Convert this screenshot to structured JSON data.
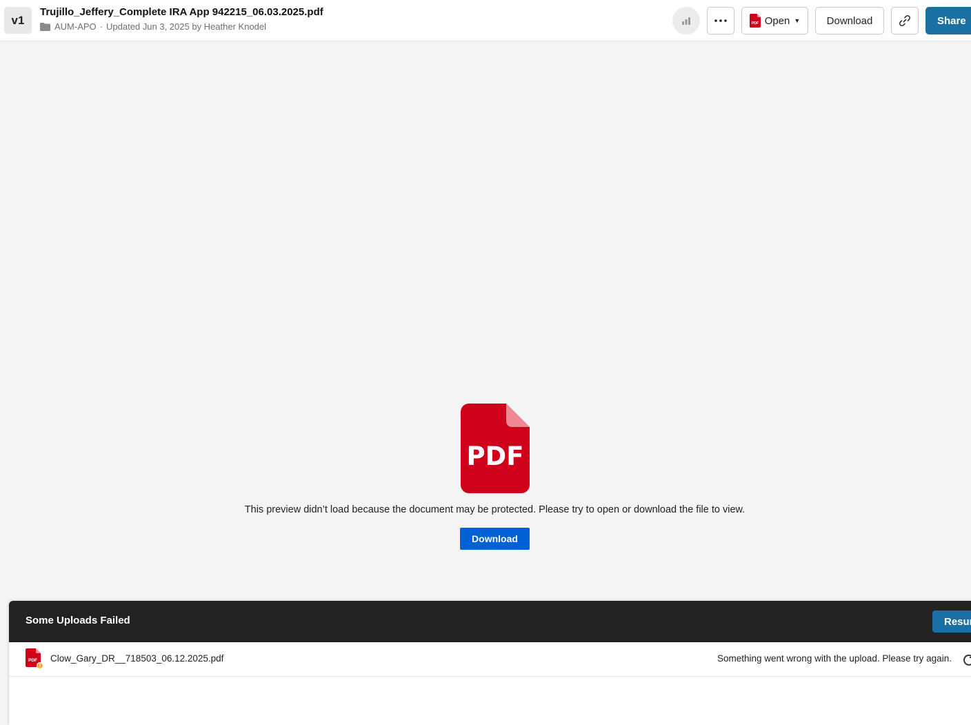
{
  "header": {
    "version": "v1",
    "file_title": "Trujillo_Jeffery_Complete IRA App 942215_06.03.2025.pdf",
    "folder_name": "AUM-APO",
    "separator": "·",
    "updated_text": "Updated Jun 3, 2025 by Heather Knodel",
    "open_label": "Open",
    "download_label": "Download",
    "share_label": "Share",
    "icons": [
      "stats-icon",
      "more-icon",
      "pdf-icon",
      "chevron-down-icon",
      "link-icon",
      "folder-icon"
    ]
  },
  "preview": {
    "icon_text": "PDF",
    "message": "This preview didn’t load because the document may be protected. Please try to open or download the file to view.",
    "download_label": "Download"
  },
  "uploads": {
    "title": "Some Uploads Failed",
    "resume_label": "Resume",
    "items": [
      {
        "file_name": "Clow_Gary_DR__718503_06.12.2025.pdf",
        "error": "Something went wrong with the upload. Please try again.",
        "file_icon_text": "PDF"
      }
    ]
  },
  "colors": {
    "share_blue": "#1a6fa3",
    "primary_blue": "#0061d5",
    "pdf_red": "#d0021b",
    "warning_orange": "#f5a623"
  }
}
